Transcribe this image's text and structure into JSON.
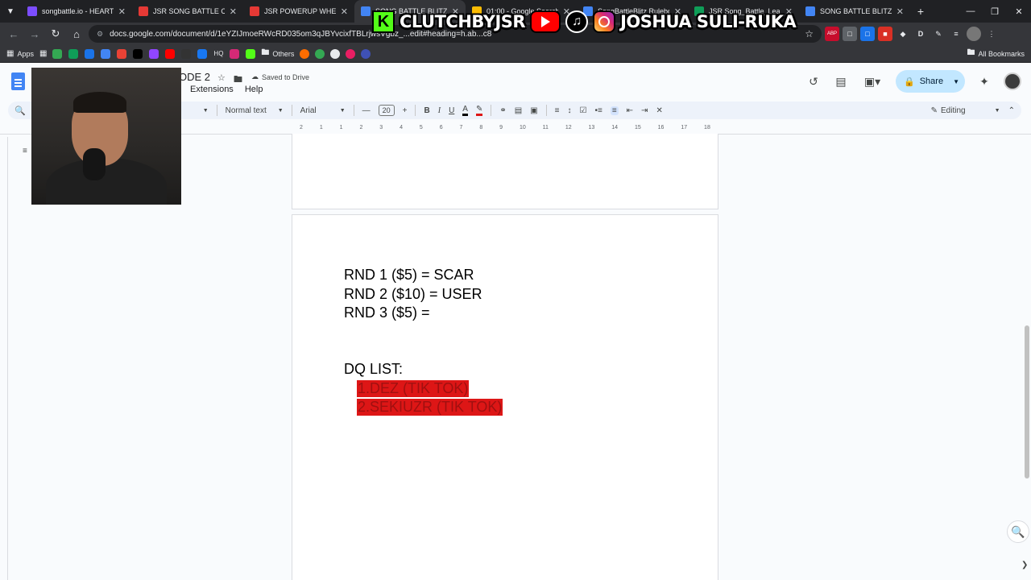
{
  "browser": {
    "tabs": [
      {
        "label": "songbattle.io - HEARTBRE",
        "color": "#7c4dff",
        "active": false
      },
      {
        "label": "JSR SONG BATTLE CATEG",
        "color": "#e53935",
        "active": false
      },
      {
        "label": "JSR POWERUP WHEEL",
        "color": "#e53935",
        "active": false
      },
      {
        "label": "SONG BATTLE BLITZ COM",
        "color": "#4285f4",
        "active": true
      },
      {
        "label": "01:00 - Google Search",
        "color": "#fbbc04",
        "active": false
      },
      {
        "label": "SongBattleBlitz Ruleboo",
        "color": "#4285f4",
        "active": false
      },
      {
        "label": "JSR Song_Battle_League_",
        "color": "#0f9d58",
        "active": false
      },
      {
        "label": "SONG BATTLE BLITZ COM",
        "color": "#4285f4",
        "active": false
      }
    ],
    "new_tab": "+",
    "url": "docs.google.com/document/d/1eYZIJmoeRWcRD035om3qJBYvcixfTBLrjwsVgbz_...edit#heading=h.ab...c8",
    "bookmarks": {
      "apps_label": "Apps",
      "others_label": "Others",
      "all_label": "All Bookmarks",
      "icons": [
        {
          "name": "drive-bookmark",
          "color": "#34a853"
        },
        {
          "name": "sheets-bookmark",
          "color": "#0f9d58"
        },
        {
          "name": "meet-bookmark",
          "color": "#1a73e8"
        },
        {
          "name": "docs-bookmark",
          "color": "#4285f4"
        },
        {
          "name": "chart-bookmark",
          "color": "#e94235"
        },
        {
          "name": "tiktok-bookmark",
          "color": "#000000"
        },
        {
          "name": "twitch-bookmark",
          "color": "#9146ff"
        },
        {
          "name": "youtube-bookmark",
          "color": "#ff0000"
        },
        {
          "name": "x-bookmark",
          "color": "#333333"
        },
        {
          "name": "facebook-bookmark",
          "color": "#1877f2"
        },
        {
          "name": "instagram-bookmark",
          "color": "#d62976"
        },
        {
          "name": "kick-bookmark",
          "color": "#53fc18"
        }
      ],
      "hq_label": "HQ"
    }
  },
  "docs": {
    "title": "ODE 2",
    "saved_status": "Saved to Drive",
    "menus": [
      "Extensions",
      "Help"
    ],
    "share_label": "Share",
    "toolbar": {
      "style": "Normal text",
      "font": "Arial",
      "font_size": "20",
      "mode": "Editing"
    },
    "ruler_ticks": [
      "2",
      "1",
      "1",
      "2",
      "3",
      "4",
      "5",
      "6",
      "7",
      "8",
      "9",
      "10",
      "11",
      "12",
      "13",
      "14",
      "15",
      "16",
      "17",
      "18"
    ],
    "content": {
      "rounds": [
        "RND 1 ($5) = SCAR",
        "RND 2 ($10) = USER",
        "RND 3 ($5) ="
      ],
      "dq_heading": "DQ LIST:",
      "dq_items": [
        {
          "num": "1.",
          "text": "DEZ (TIK TOK)"
        },
        {
          "num": "2.",
          "text": "SEKIUZR (TIK TOK)"
        }
      ]
    }
  },
  "overlay": {
    "kick_handle": "CLUTCHBYJSR",
    "name": "JOSHUA SULI-RUKA",
    "kick_letter": "K"
  },
  "colors": {
    "highlight": "#dd1616",
    "share_bg": "#c2e7ff",
    "toolbar_bg": "#edf2fa"
  }
}
